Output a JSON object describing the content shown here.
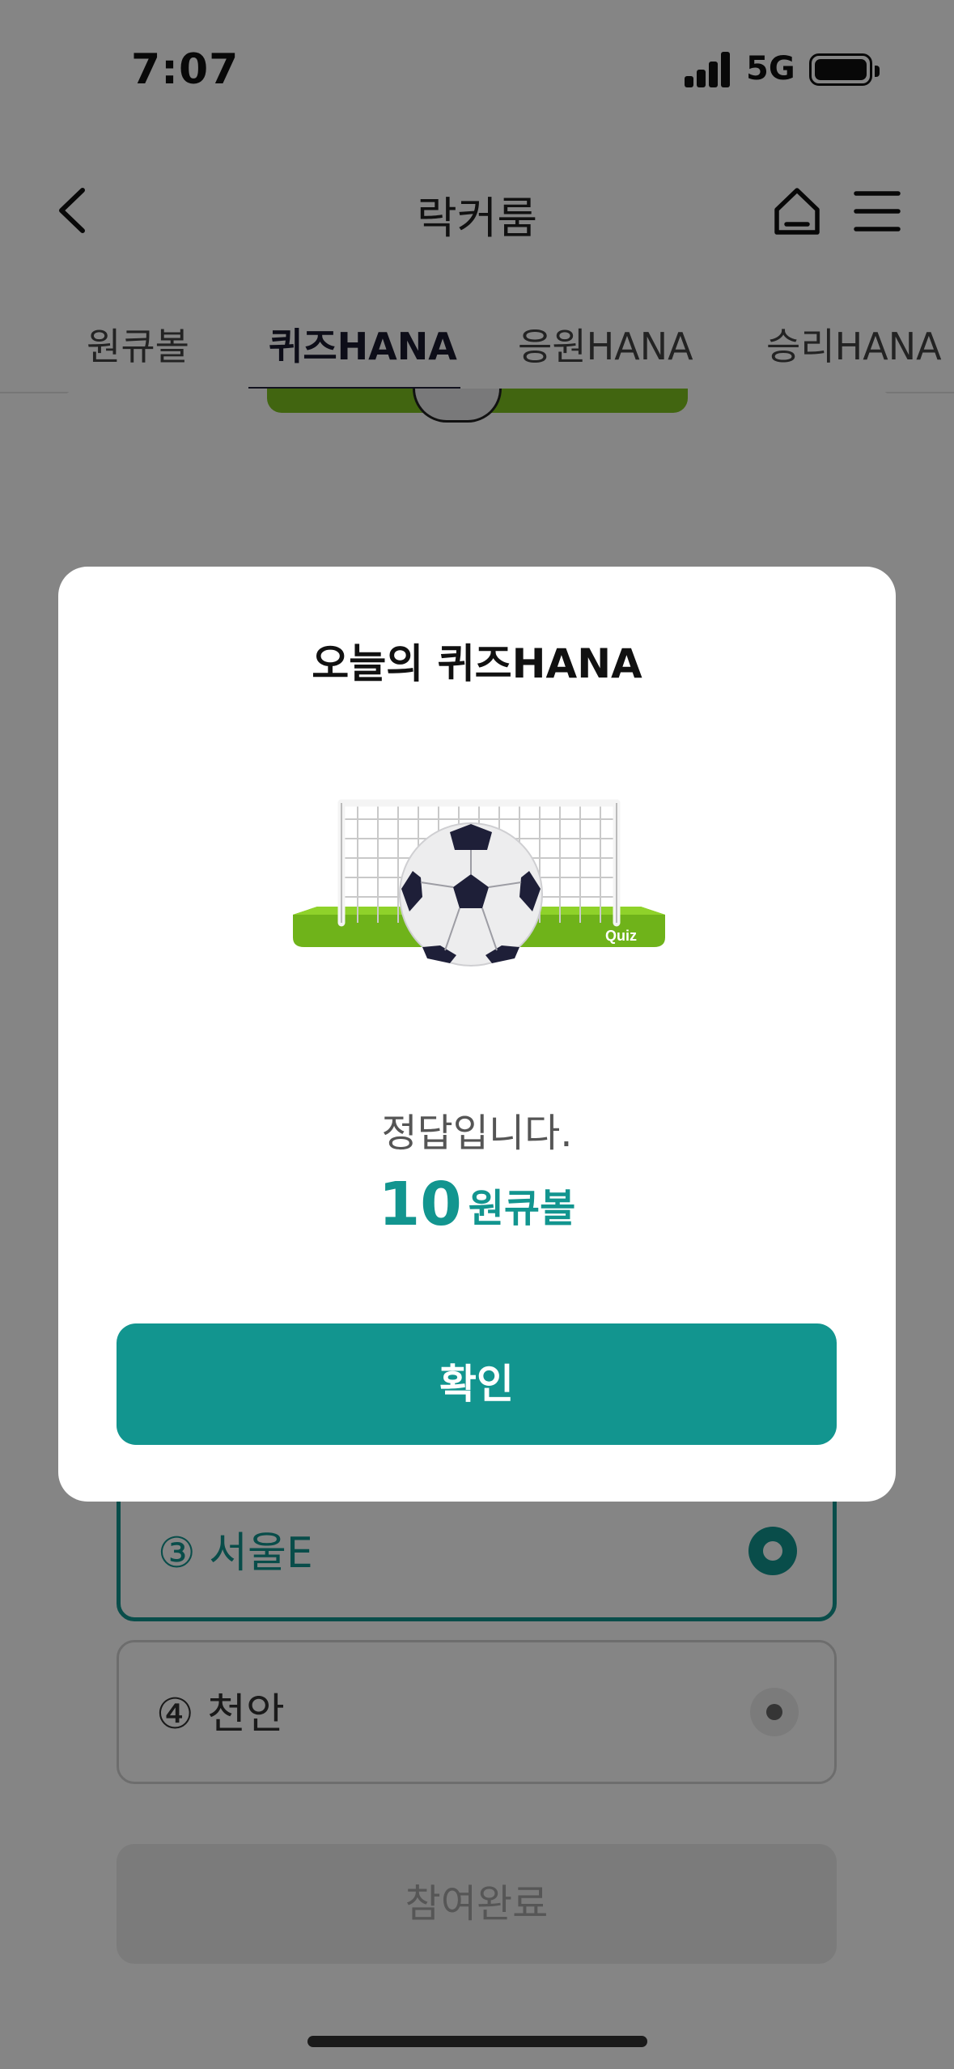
{
  "status_bar": {
    "time": "7:07",
    "network": "5G"
  },
  "header": {
    "title": "락커룸",
    "back_icon": "chevron-left-icon",
    "home_icon": "home-icon",
    "menu_icon": "hamburger-menu-icon"
  },
  "tabs": [
    {
      "label": "원큐볼",
      "active": false
    },
    {
      "label": "퀴즈HANA",
      "active": true
    },
    {
      "label": "응원HANA",
      "active": false
    },
    {
      "label": "승리HANA",
      "active": false
    }
  ],
  "quiz": {
    "options": [
      {
        "label": "③ 서울E",
        "selected": true
      },
      {
        "label": "④ 천안",
        "selected": false
      }
    ],
    "submit_label": "참여완료"
  },
  "modal": {
    "title": "오늘의 퀴즈HANA",
    "illustration": "soccer-goal-quiz-icon",
    "illustration_badge": "Quiz",
    "result_text": "정답입니다.",
    "reward_amount": "10",
    "reward_unit": "원큐볼",
    "confirm_label": "확인"
  },
  "colors": {
    "accent": "#12958f",
    "tab_active": "#23233d",
    "disabled_bg": "#ececec"
  }
}
